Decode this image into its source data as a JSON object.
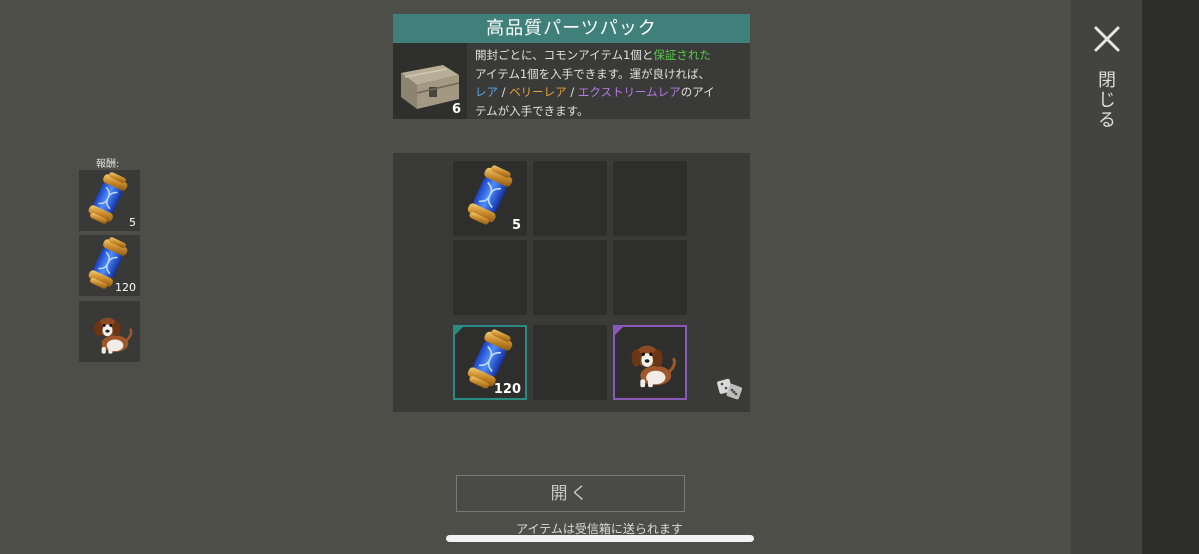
{
  "header": {
    "title": "高品質パーツパック",
    "crate_count": "6",
    "desc": {
      "line1_a": "開封ごとに、コモンアイテム1個と",
      "line1_b": "保証された",
      "line2": "アイテム1個を入手できます。運が良ければ、",
      "line3_rare": "レア",
      "line3_sep1": " / ",
      "line3_veryrare": "ベリーレア",
      "line3_sep2": " / ",
      "line3_extreme": "エクストリームレア",
      "line3_tail": "のアイ",
      "line4": "テムが入手できます。"
    }
  },
  "rewards": {
    "label": "報酬:",
    "items": [
      {
        "icon": "dna-capsule-icon",
        "count": "5"
      },
      {
        "icon": "dna-capsule-icon",
        "count": "120"
      },
      {
        "icon": "dog-icon",
        "count": ""
      }
    ]
  },
  "grid": {
    "cells": [
      {
        "icon": "dna-capsule-icon",
        "count": "5"
      },
      {
        "icon": "",
        "count": ""
      },
      {
        "icon": "",
        "count": ""
      },
      {
        "icon": "",
        "count": ""
      },
      {
        "icon": "",
        "count": ""
      },
      {
        "icon": "",
        "count": ""
      },
      {
        "icon": "dna-capsule-icon",
        "count": "120",
        "rarity": "teal"
      },
      {
        "icon": "",
        "count": ""
      },
      {
        "icon": "dog-icon",
        "count": "",
        "rarity": "violet"
      }
    ],
    "random_icon": "dice-icon"
  },
  "close": {
    "label": "閉じる",
    "icon": "close-icon"
  },
  "actions": {
    "open_label": "開く",
    "inbox_note": "アイテムは受信箱に送られます"
  },
  "colors": {
    "accent": "#3f807a",
    "rare_teal": "#2b8a82",
    "rare_violet": "#8a58b8"
  }
}
